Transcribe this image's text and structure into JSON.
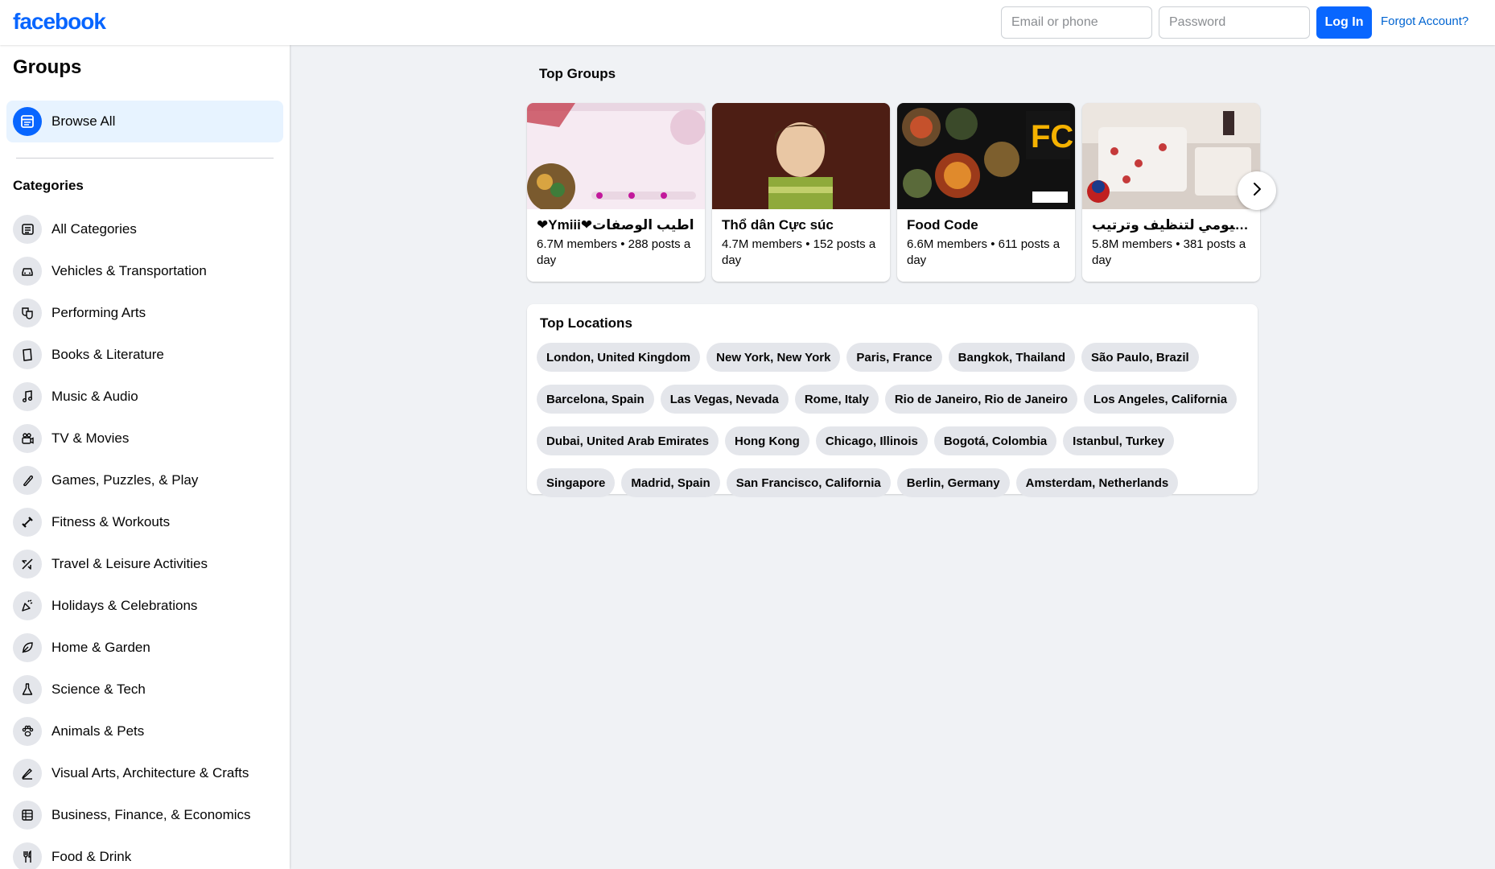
{
  "header": {
    "logo_text": "facebook",
    "email_placeholder": "Email or phone",
    "password_placeholder": "Password",
    "login_label": "Log In",
    "forgot_label": "Forgot Account?"
  },
  "colors": {
    "brand": "#0866ff",
    "page_bg": "#f0f2f5",
    "chip_bg": "#e4e6eb",
    "selected_bg": "#e7f3ff"
  },
  "sidebar": {
    "title": "Groups",
    "browse_all": "Browse All",
    "categories_title": "Categories",
    "categories": [
      {
        "label": "All Categories",
        "icon": "list-icon"
      },
      {
        "label": "Vehicles & Transportation",
        "icon": "car-icon"
      },
      {
        "label": "Performing Arts",
        "icon": "theater-masks-icon"
      },
      {
        "label": "Books & Literature",
        "icon": "book-icon"
      },
      {
        "label": "Music & Audio",
        "icon": "music-note-icon"
      },
      {
        "label": "TV & Movies",
        "icon": "video-camera-icon"
      },
      {
        "label": "Games, Puzzles, & Play",
        "icon": "game-controller-icon"
      },
      {
        "label": "Fitness & Workouts",
        "icon": "dumbbell-icon"
      },
      {
        "label": "Travel & Leisure Activities",
        "icon": "airplane-icon"
      },
      {
        "label": "Holidays & Celebrations",
        "icon": "party-icon"
      },
      {
        "label": "Home & Garden",
        "icon": "leaf-icon"
      },
      {
        "label": "Science & Tech",
        "icon": "flask-icon"
      },
      {
        "label": "Animals & Pets",
        "icon": "paw-icon"
      },
      {
        "label": "Visual Arts, Architecture & Crafts",
        "icon": "pen-icon"
      },
      {
        "label": "Business, Finance, & Economics",
        "icon": "ledger-icon"
      },
      {
        "label": "Food & Drink",
        "icon": "utensils-icon"
      }
    ]
  },
  "top_groups": {
    "title": "Top Groups",
    "groups": [
      {
        "name": "❤Ymiii❤اطيب الوصفات",
        "meta": "6.7M members • 288 posts a day"
      },
      {
        "name": "Thổ dân Cực súc",
        "meta": "4.7M members • 152 posts a day"
      },
      {
        "name": "Food Code",
        "meta": "6.6M members • 611 posts a day"
      },
      {
        "name": "الروتين اليومي لتنظيف وترتيب",
        "meta": "5.8M members • 381 posts a day"
      }
    ],
    "next_icon": "chevron-right-icon"
  },
  "top_locations": {
    "title": "Top Locations",
    "locations": [
      "London, United Kingdom",
      "New York, New York",
      "Paris, France",
      "Bangkok, Thailand",
      "São Paulo, Brazil",
      "Barcelona, Spain",
      "Las Vegas, Nevada",
      "Rome, Italy",
      "Rio de Janeiro, Rio de Janeiro",
      "Los Angeles, California",
      "Dubai, United Arab Emirates",
      "Hong Kong",
      "Chicago, Illinois",
      "Bogotá, Colombia",
      "Istanbul, Turkey",
      "Singapore",
      "Madrid, Spain",
      "San Francisco, California",
      "Berlin, Germany",
      "Amsterdam, Netherlands"
    ]
  }
}
